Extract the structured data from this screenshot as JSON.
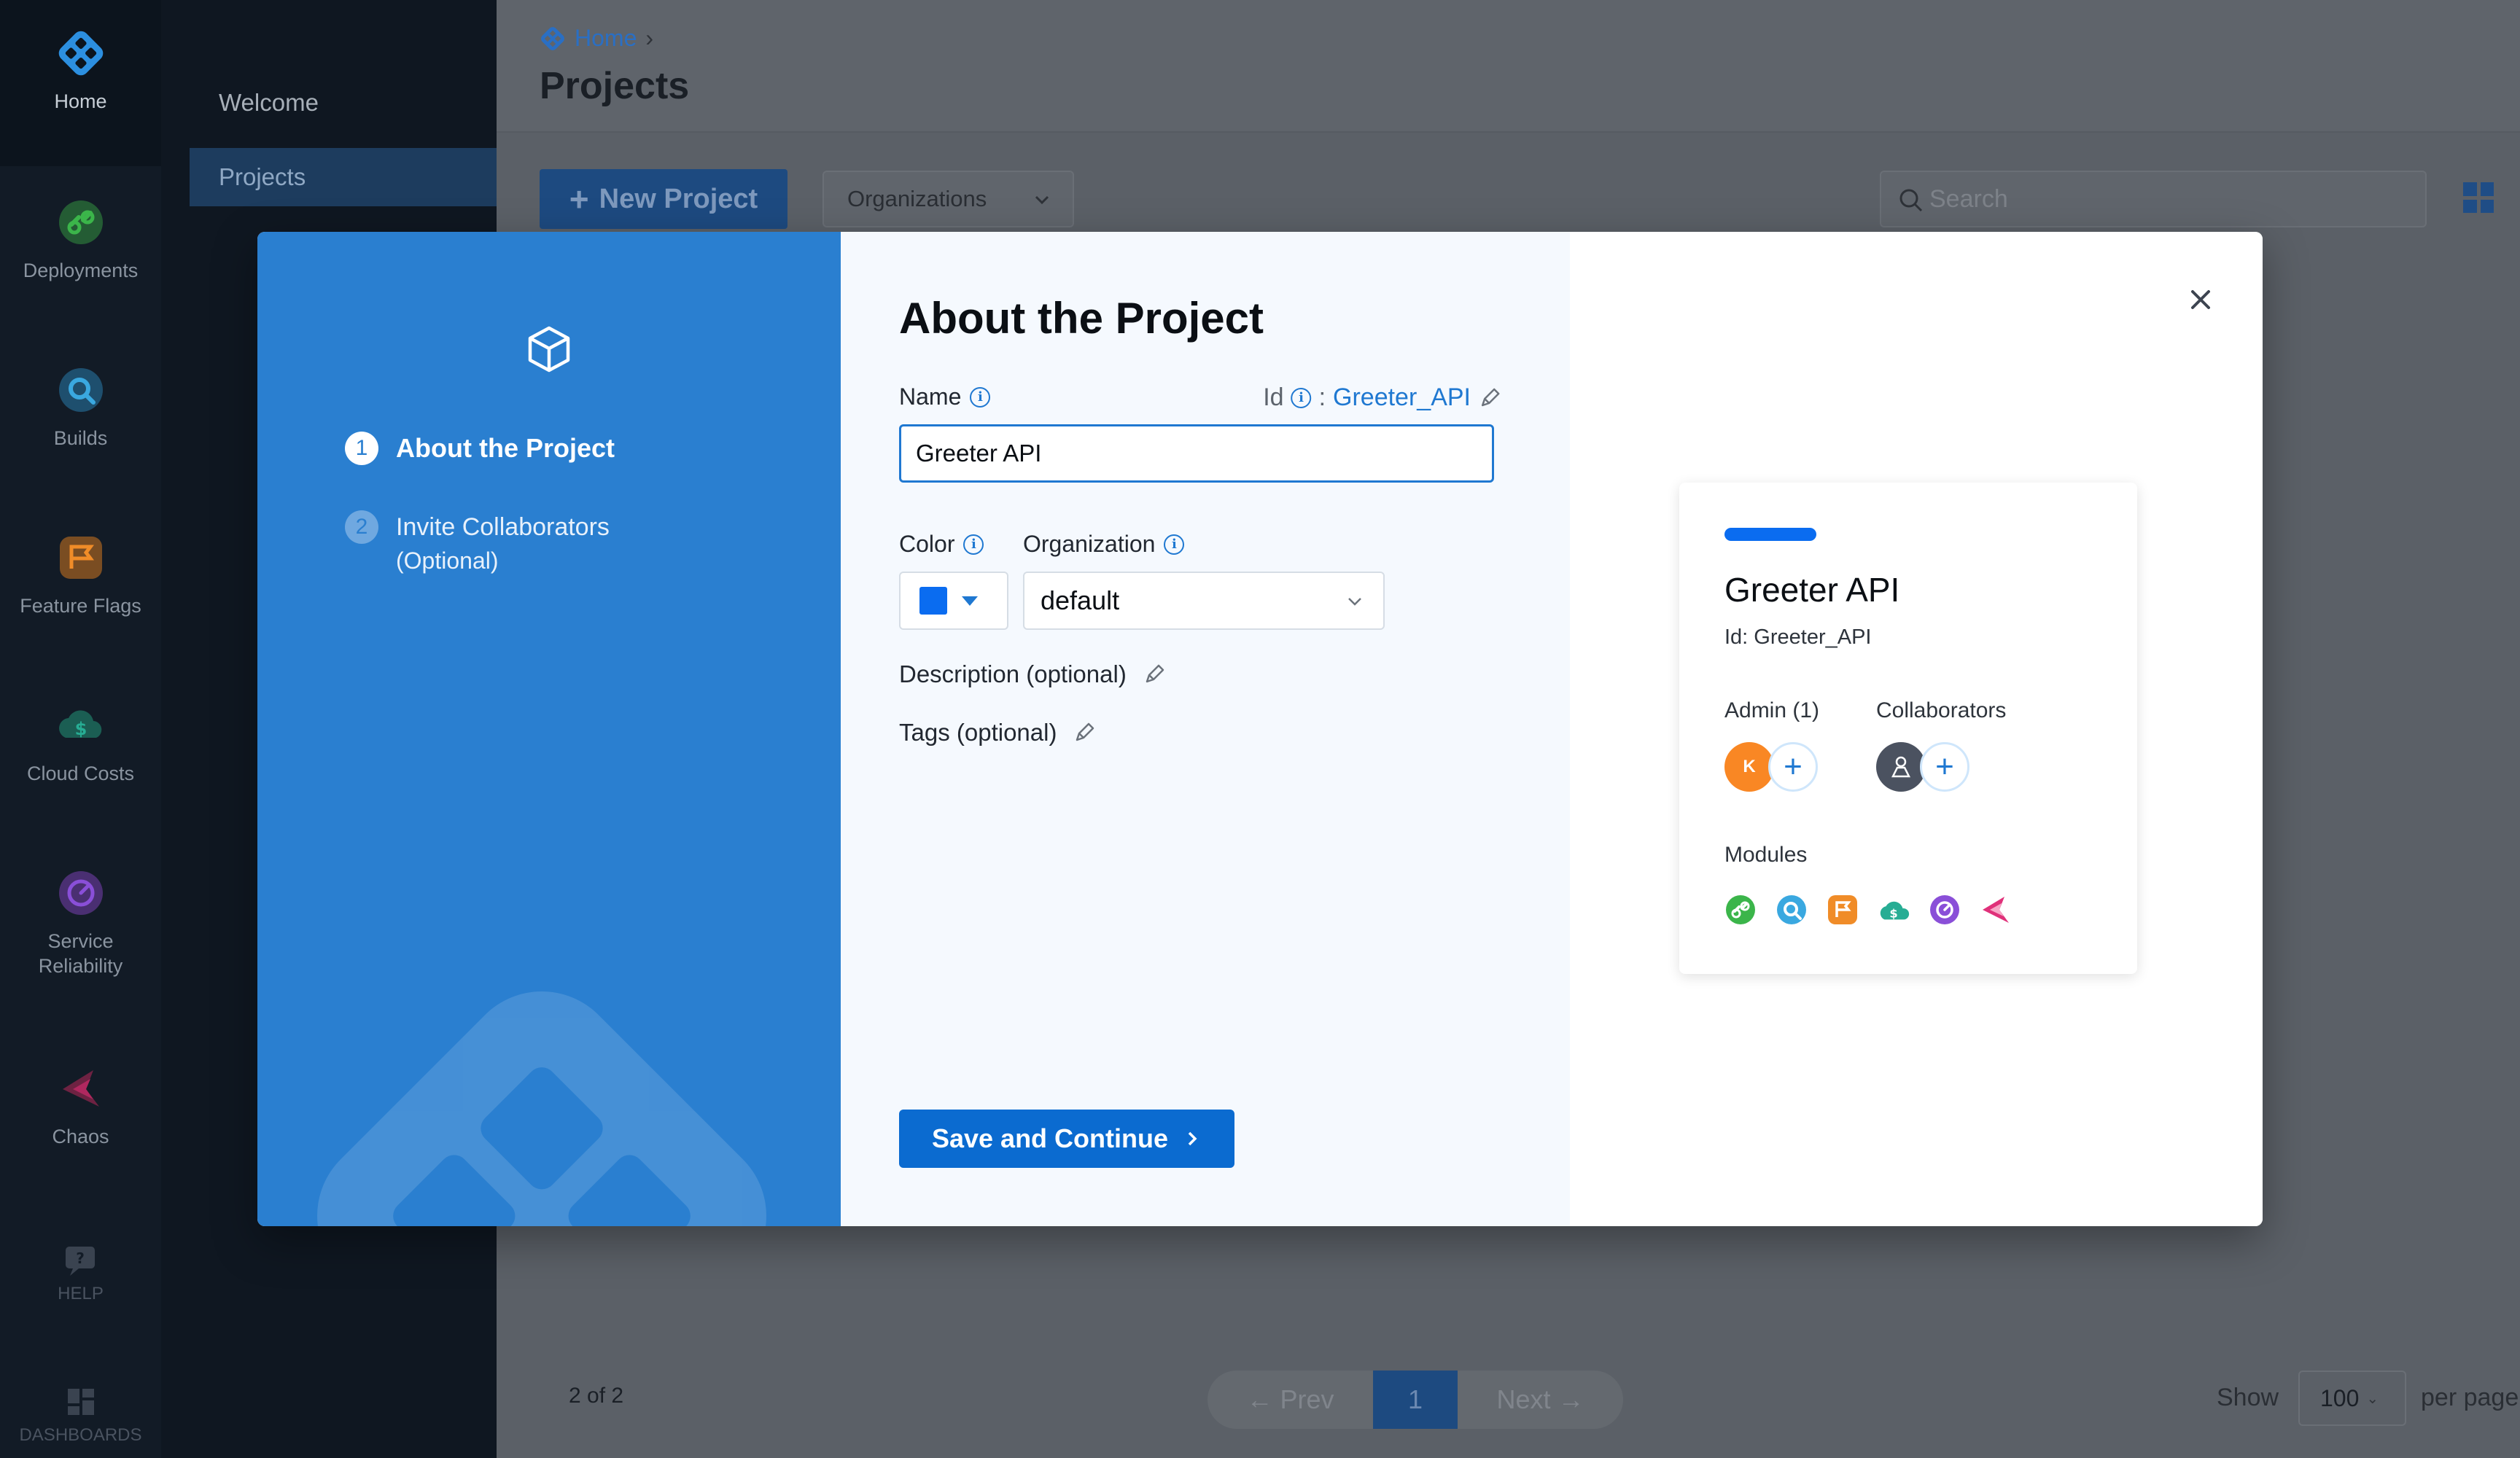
{
  "nav": {
    "items": [
      {
        "label": "Home",
        "icon": "harness-logo-icon"
      },
      {
        "label": "Deployments",
        "icon": "deployments-icon",
        "color": "#3bb54a"
      },
      {
        "label": "Builds",
        "icon": "builds-icon",
        "color": "#3aa8e0"
      },
      {
        "label": "Feature Flags",
        "icon": "feature-flags-icon",
        "color": "#f08c28"
      },
      {
        "label": "Cloud Costs",
        "icon": "cloud-costs-icon",
        "color": "#27ad94"
      },
      {
        "label": "Service Reliability",
        "label_line1": "Service",
        "label_line2": "Reliability",
        "icon": "service-reliability-icon",
        "color": "#8a4fd8"
      },
      {
        "label": "Chaos",
        "icon": "chaos-icon",
        "color": "#e0317a"
      },
      {
        "label": "HELP",
        "icon": "help-icon"
      },
      {
        "label": "DASHBOARDS",
        "icon": "dashboards-icon"
      }
    ]
  },
  "subnav": {
    "items": [
      "Welcome",
      "Projects"
    ],
    "active": "Projects"
  },
  "header": {
    "breadcrumb": "Home",
    "title": "Projects"
  },
  "toolbar": {
    "new_project_label": "New Project",
    "org_filter_label": "Organizations",
    "search_placeholder": "Search"
  },
  "footer": {
    "count": "2 of 2",
    "prev": "Prev",
    "page": "1",
    "next": "Next",
    "show_label": "Show",
    "page_size": "100",
    "per_page_label": "per page"
  },
  "modal": {
    "steps": [
      {
        "number": "1",
        "label": "About the Project",
        "active": true
      },
      {
        "number": "2",
        "label": "Invite Collaborators",
        "sub": "(Optional)",
        "active": false
      }
    ],
    "form": {
      "title": "About the Project",
      "name_label": "Name",
      "name_value": "Greeter API",
      "id_label": "Id",
      "id_value": "Greeter_API",
      "color_label": "Color",
      "color_value": "#0a6cf0",
      "organization_label": "Organization",
      "organization_value": "default",
      "description_label": "Description (optional)",
      "tags_label": "Tags (optional)",
      "save_label": "Save and Continue"
    },
    "preview": {
      "name": "Greeter API",
      "id_text": "Id: Greeter_API",
      "admin_label": "Admin (1)",
      "admin_initial": "K",
      "collaborators_label": "Collaborators",
      "modules_label": "Modules",
      "modules": [
        "deployments-icon",
        "builds-icon",
        "feature-flags-icon",
        "cloud-costs-icon",
        "service-reliability-icon",
        "chaos-icon"
      ]
    }
  }
}
